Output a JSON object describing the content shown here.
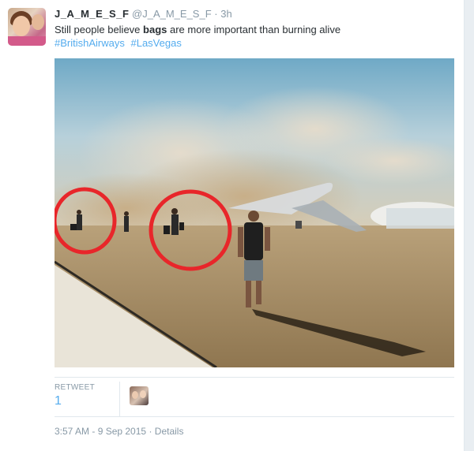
{
  "tweet": {
    "display_name": "J_A_M_E_S_F",
    "handle": "@J_A_M_E_S_F",
    "separator": "·",
    "time": "3h",
    "text_before": "Still people believe ",
    "text_bold": "bags",
    "text_after": " are more important than burning alive",
    "hashtags": [
      "#BritishAirways",
      "#LasVegas"
    ]
  },
  "stats": {
    "retweet_label": "RETWEET",
    "retweet_count": "1"
  },
  "meta": {
    "timestamp": "3:57 AM - 9 Sep 2015",
    "separator": "·",
    "details_label": "Details"
  },
  "colors": {
    "link": "#55acee",
    "muted": "#8899a6",
    "circle": "#e8262a"
  }
}
